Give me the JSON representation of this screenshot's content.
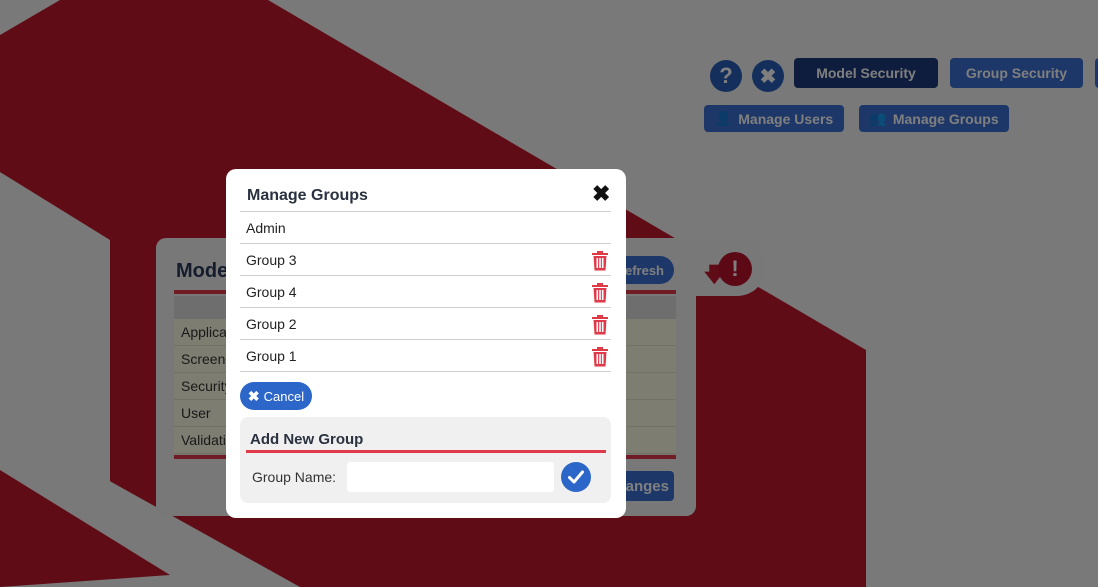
{
  "colors": {
    "accent_red": "#e0394a",
    "brand_blue": "#3a6fd0",
    "brand_dark": "#1c3a7a",
    "shape_red": "#c0192c"
  },
  "toolbar": {
    "help_icon": "question-icon",
    "close_icon": "close-icon",
    "model_security_label": "Model Security",
    "group_security_label": "Group Security",
    "manage_users_label": "Manage Users",
    "manage_groups_label": "Manage Groups"
  },
  "panel": {
    "title": "Mode",
    "refresh_label": "efresh",
    "changes_label": "anges",
    "rows": [
      "Applica",
      "Screen",
      "Security",
      "User",
      "Validati"
    ]
  },
  "modal": {
    "title": "Manage Groups",
    "groups": [
      {
        "name": "Admin",
        "deletable": false
      },
      {
        "name": "Group 3",
        "deletable": true
      },
      {
        "name": "Group 4",
        "deletable": true
      },
      {
        "name": "Group 2",
        "deletable": true
      },
      {
        "name": "Group 1",
        "deletable": true
      }
    ],
    "cancel_label": "Cancel",
    "add_title": "Add New Group",
    "group_name_label": "Group Name:",
    "group_name_value": "",
    "group_name_placeholder": ""
  }
}
